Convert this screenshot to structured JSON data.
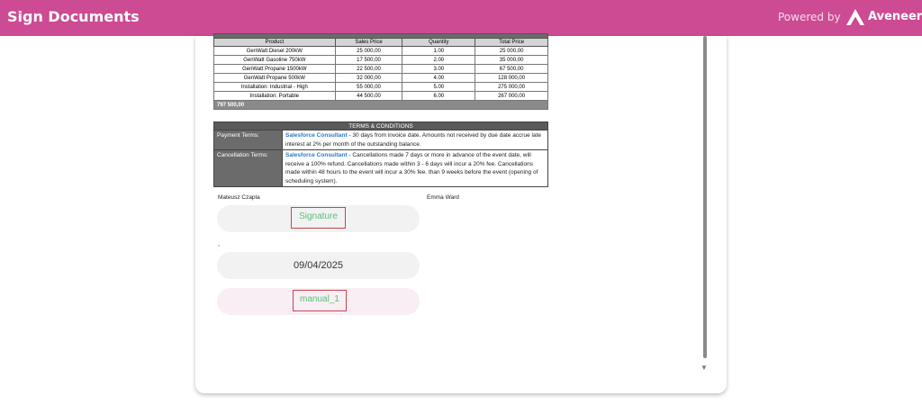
{
  "header": {
    "title": "Sign Documents",
    "powered_by": "Powered by",
    "brand": "Aveneer",
    "colors": {
      "bar": "#cc4b93"
    }
  },
  "products_table": {
    "columns": [
      "Product",
      "Sales Price",
      "Quantity",
      "Total Price"
    ],
    "rows": [
      [
        "GenWatt Diesel 200kW",
        "25 000,00",
        "1.00",
        "25 000,00"
      ],
      [
        "GenWatt Gasoline 750kW",
        "17 500,00",
        "2.00",
        "35 000,00"
      ],
      [
        "GenWatt Propane 1500kW",
        "22 500,00",
        "3.00",
        "67 500,00"
      ],
      [
        "GenWatt Propane 500kW",
        "32 000,00",
        "4.00",
        "128 000,00"
      ],
      [
        "Installation: Industrial - High",
        "55 000,00",
        "5.00",
        "275 000,00"
      ],
      [
        "Installation: Portable",
        "44 500,00",
        "6.00",
        "267 000,00"
      ]
    ],
    "total": "797 500,00"
  },
  "terms": {
    "title": "TERMS & CONDITIONS",
    "payment_label": "Payment Terms:",
    "payment_company": "Salesforce Consultant",
    "payment_text": " - 30 days from invoice date. Amounts not received by due date accrue late interest at 2% per month of the outstanding balance.",
    "cancel_label": "Cancellation Terms:",
    "cancel_company": "Salesforce Consultant",
    "cancel_text": " - Cancellations made 7 days or more in advance of the event date, will receive a 100% refund. Cancellations made within 3 - 6 days will incur a 20% fee. Cancellations made within 48 hours to the event will incur a 30% fee. than 9 weeks before the event (opening of scheduling system)."
  },
  "signers": {
    "left": "Mateusz Czapla",
    "right": "Emma Ward"
  },
  "fields": {
    "signature_label": "Signature",
    "mark": ",",
    "date_value": "09/04/2025",
    "manual_label": "manual_1"
  }
}
